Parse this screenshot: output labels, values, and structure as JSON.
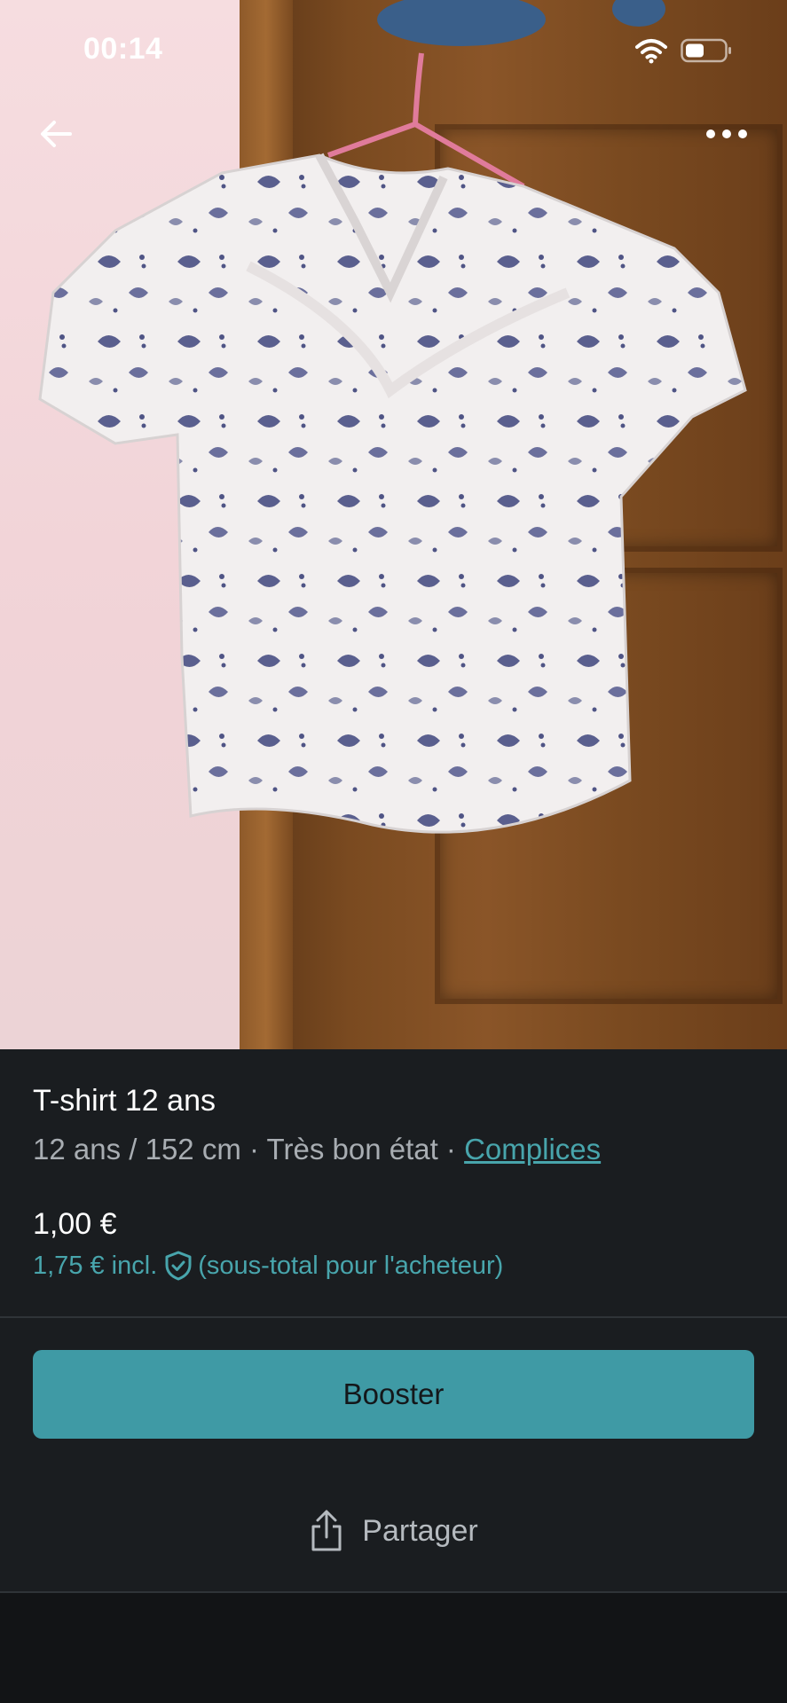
{
  "status_bar": {
    "time": "00:14",
    "icons": [
      "wifi-icon",
      "battery-icon"
    ]
  },
  "header": {
    "back_icon": "arrow-left-icon",
    "menu_icon": "more-horizontal-icon"
  },
  "item": {
    "title": "T-shirt 12 ans",
    "size": "12 ans / 152 cm",
    "separator": " · ",
    "condition": "Très bon état",
    "brand": "Complices",
    "price": "1,00 €",
    "price_incl": "1,75 € incl.",
    "price_incl_note": "(sous-total pour l'acheteur)",
    "protection_icon": "shield-check-icon"
  },
  "actions": {
    "booster_label": "Booster",
    "share_label": "Partager",
    "share_icon": "share-icon"
  },
  "colors": {
    "background": "#1a1d20",
    "accent": "#48a5ac",
    "button": "#3f9aa5"
  }
}
